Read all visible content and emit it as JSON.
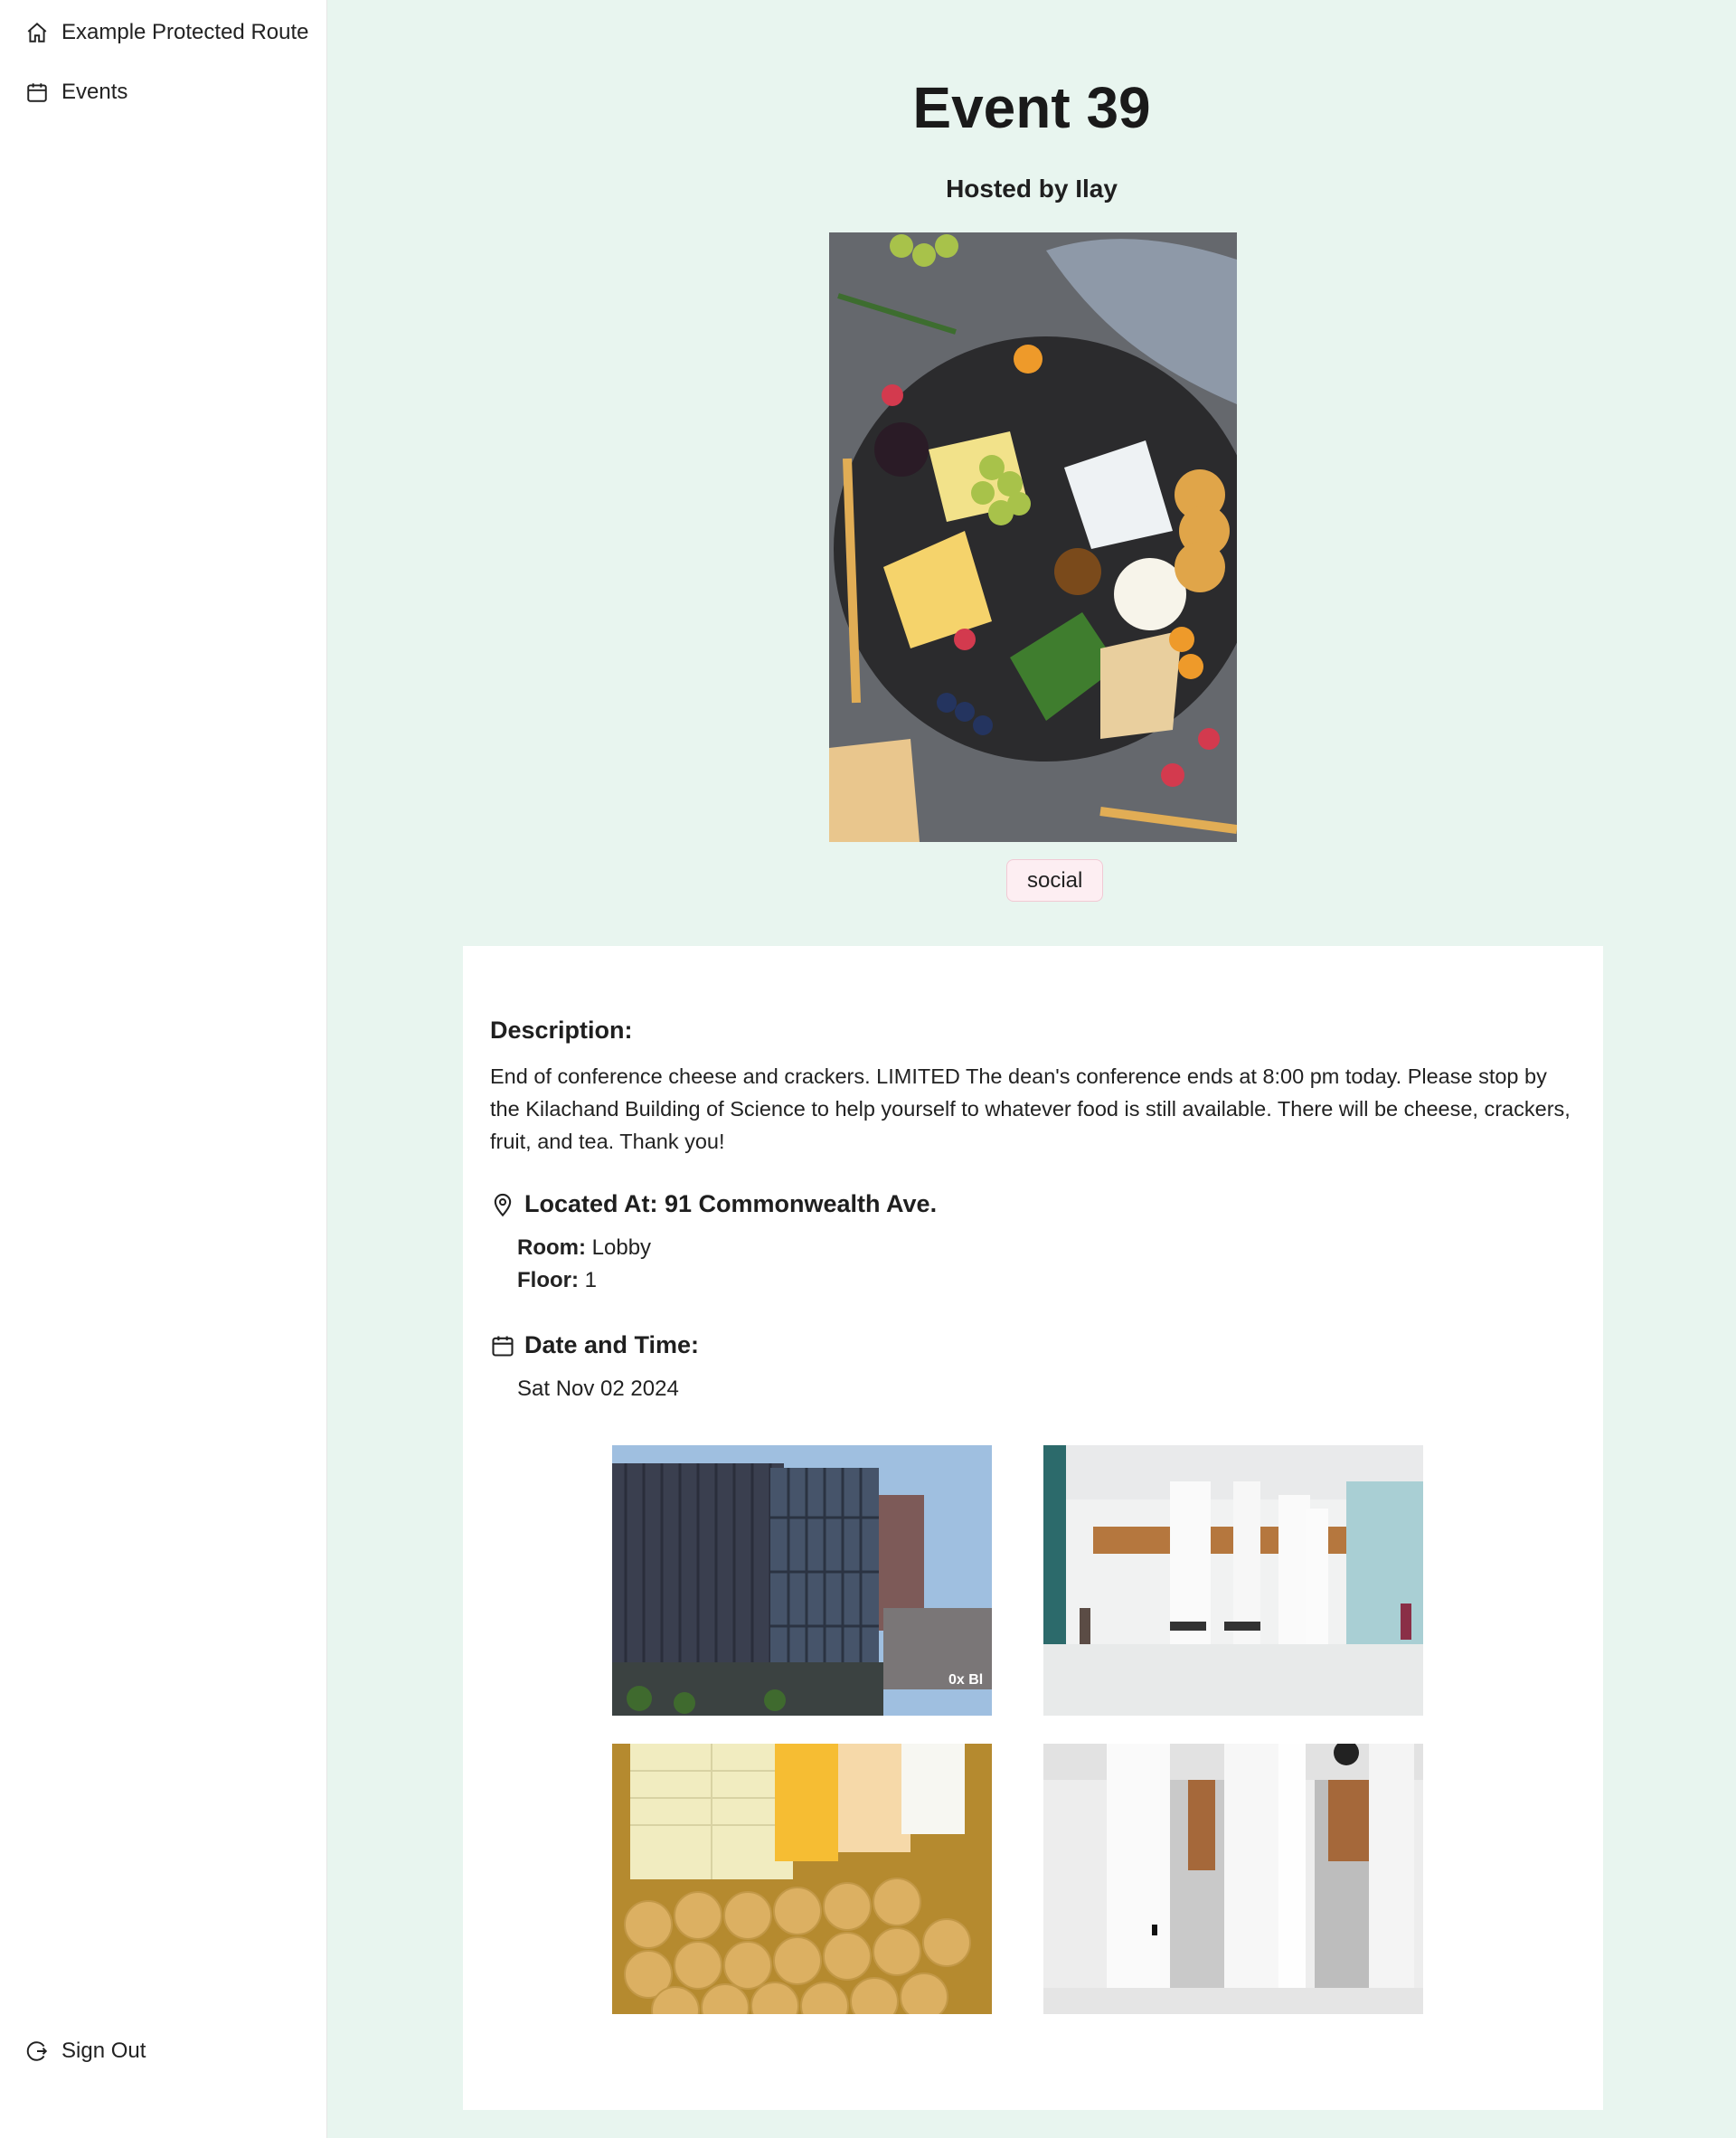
{
  "sidebar": {
    "items": [
      {
        "label": "Example Protected Route",
        "icon": "home-icon"
      },
      {
        "label": "Events",
        "icon": "calendar-icon"
      }
    ],
    "signout": {
      "label": "Sign Out",
      "icon": "sign-out-icon"
    }
  },
  "event": {
    "title": "Event 39",
    "host": "Hosted by Ilay",
    "tag": "social",
    "description_heading": "Description:",
    "description": "End of conference cheese and crackers. LIMITED The dean's conference ends at 8:00 pm today. Please stop by the Kilachand Building of Science to help yourself to whatever food is still available. There will be cheese, crackers, fruit, and tea. Thank you!",
    "location_heading": "Located At: 91 Commonwealth Ave.",
    "room_label": "Room:",
    "room_value": " Lobby",
    "floor_label": "Floor:",
    "floor_value": " 1",
    "datetime_heading": "Date and Time:",
    "date": "Sat Nov 02 2024",
    "photo_watermark": "0x Bl"
  },
  "colors": {
    "page_bg": "#e8f5ef",
    "card_bg": "#ffffff",
    "tag_bg": "#fdeef2",
    "tag_border": "#f1c9d4"
  }
}
